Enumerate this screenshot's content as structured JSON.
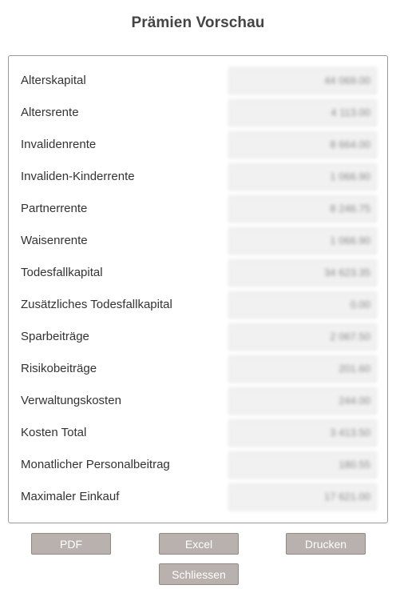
{
  "title": "Prämien Vorschau",
  "rows": [
    {
      "label": "Alterskapital",
      "value": "44 069.00"
    },
    {
      "label": "Altersrente",
      "value": "4 113.00"
    },
    {
      "label": "Invalidenrente",
      "value": "8 664.00"
    },
    {
      "label": "Invaliden-Kinderrente",
      "value": "1 066.90"
    },
    {
      "label": "Partnerrente",
      "value": "8 246.75"
    },
    {
      "label": "Waisenrente",
      "value": "1 066.90"
    },
    {
      "label": "Todesfallkapital",
      "value": "34 623.35"
    },
    {
      "label": "Zusätzliches Todesfallkapital",
      "value": "0.00"
    },
    {
      "label": "Sparbeiträge",
      "value": "2 067.50"
    },
    {
      "label": "Risikobeiträge",
      "value": "201.60"
    },
    {
      "label": "Verwaltungskosten",
      "value": "244.00"
    },
    {
      "label": "Kosten Total",
      "value": "3 413.50"
    },
    {
      "label": "Monatlicher Personalbeitrag",
      "value": "180.55"
    },
    {
      "label": "Maximaler Einkauf",
      "value": "17 621.00"
    }
  ],
  "buttons": {
    "pdf": "PDF",
    "excel": "Excel",
    "print": "Drucken",
    "close": "Schliessen"
  }
}
